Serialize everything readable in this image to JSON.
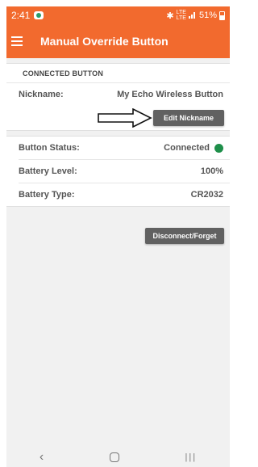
{
  "status_bar": {
    "time": "2:41",
    "network_top": "LTE",
    "network_bottom": "LTE",
    "battery_percent": "51%"
  },
  "app_bar": {
    "title": "Manual Override Button"
  },
  "connected": {
    "section_label": "CONNECTED BUTTON",
    "nickname_label": "Nickname:",
    "nickname_value": "My Echo Wireless Button",
    "edit_label": "Edit Nickname",
    "status_label": "Button Status:",
    "status_value": "Connected",
    "battery_level_label": "Battery Level:",
    "battery_level_value": "100%",
    "battery_type_label": "Battery Type:",
    "battery_type_value": "CR2032",
    "disconnect_label": "Disconnect/Forget"
  },
  "colors": {
    "app_bar": "#f26a2e",
    "connected_indicator": "#1e8f4a",
    "button_gray": "#616161"
  },
  "icons": [
    "menu-icon",
    "bluetooth-icon",
    "signal-icon",
    "battery-icon",
    "back-nav-icon",
    "home-nav-icon",
    "recents-nav-icon",
    "arrow-annotation"
  ]
}
